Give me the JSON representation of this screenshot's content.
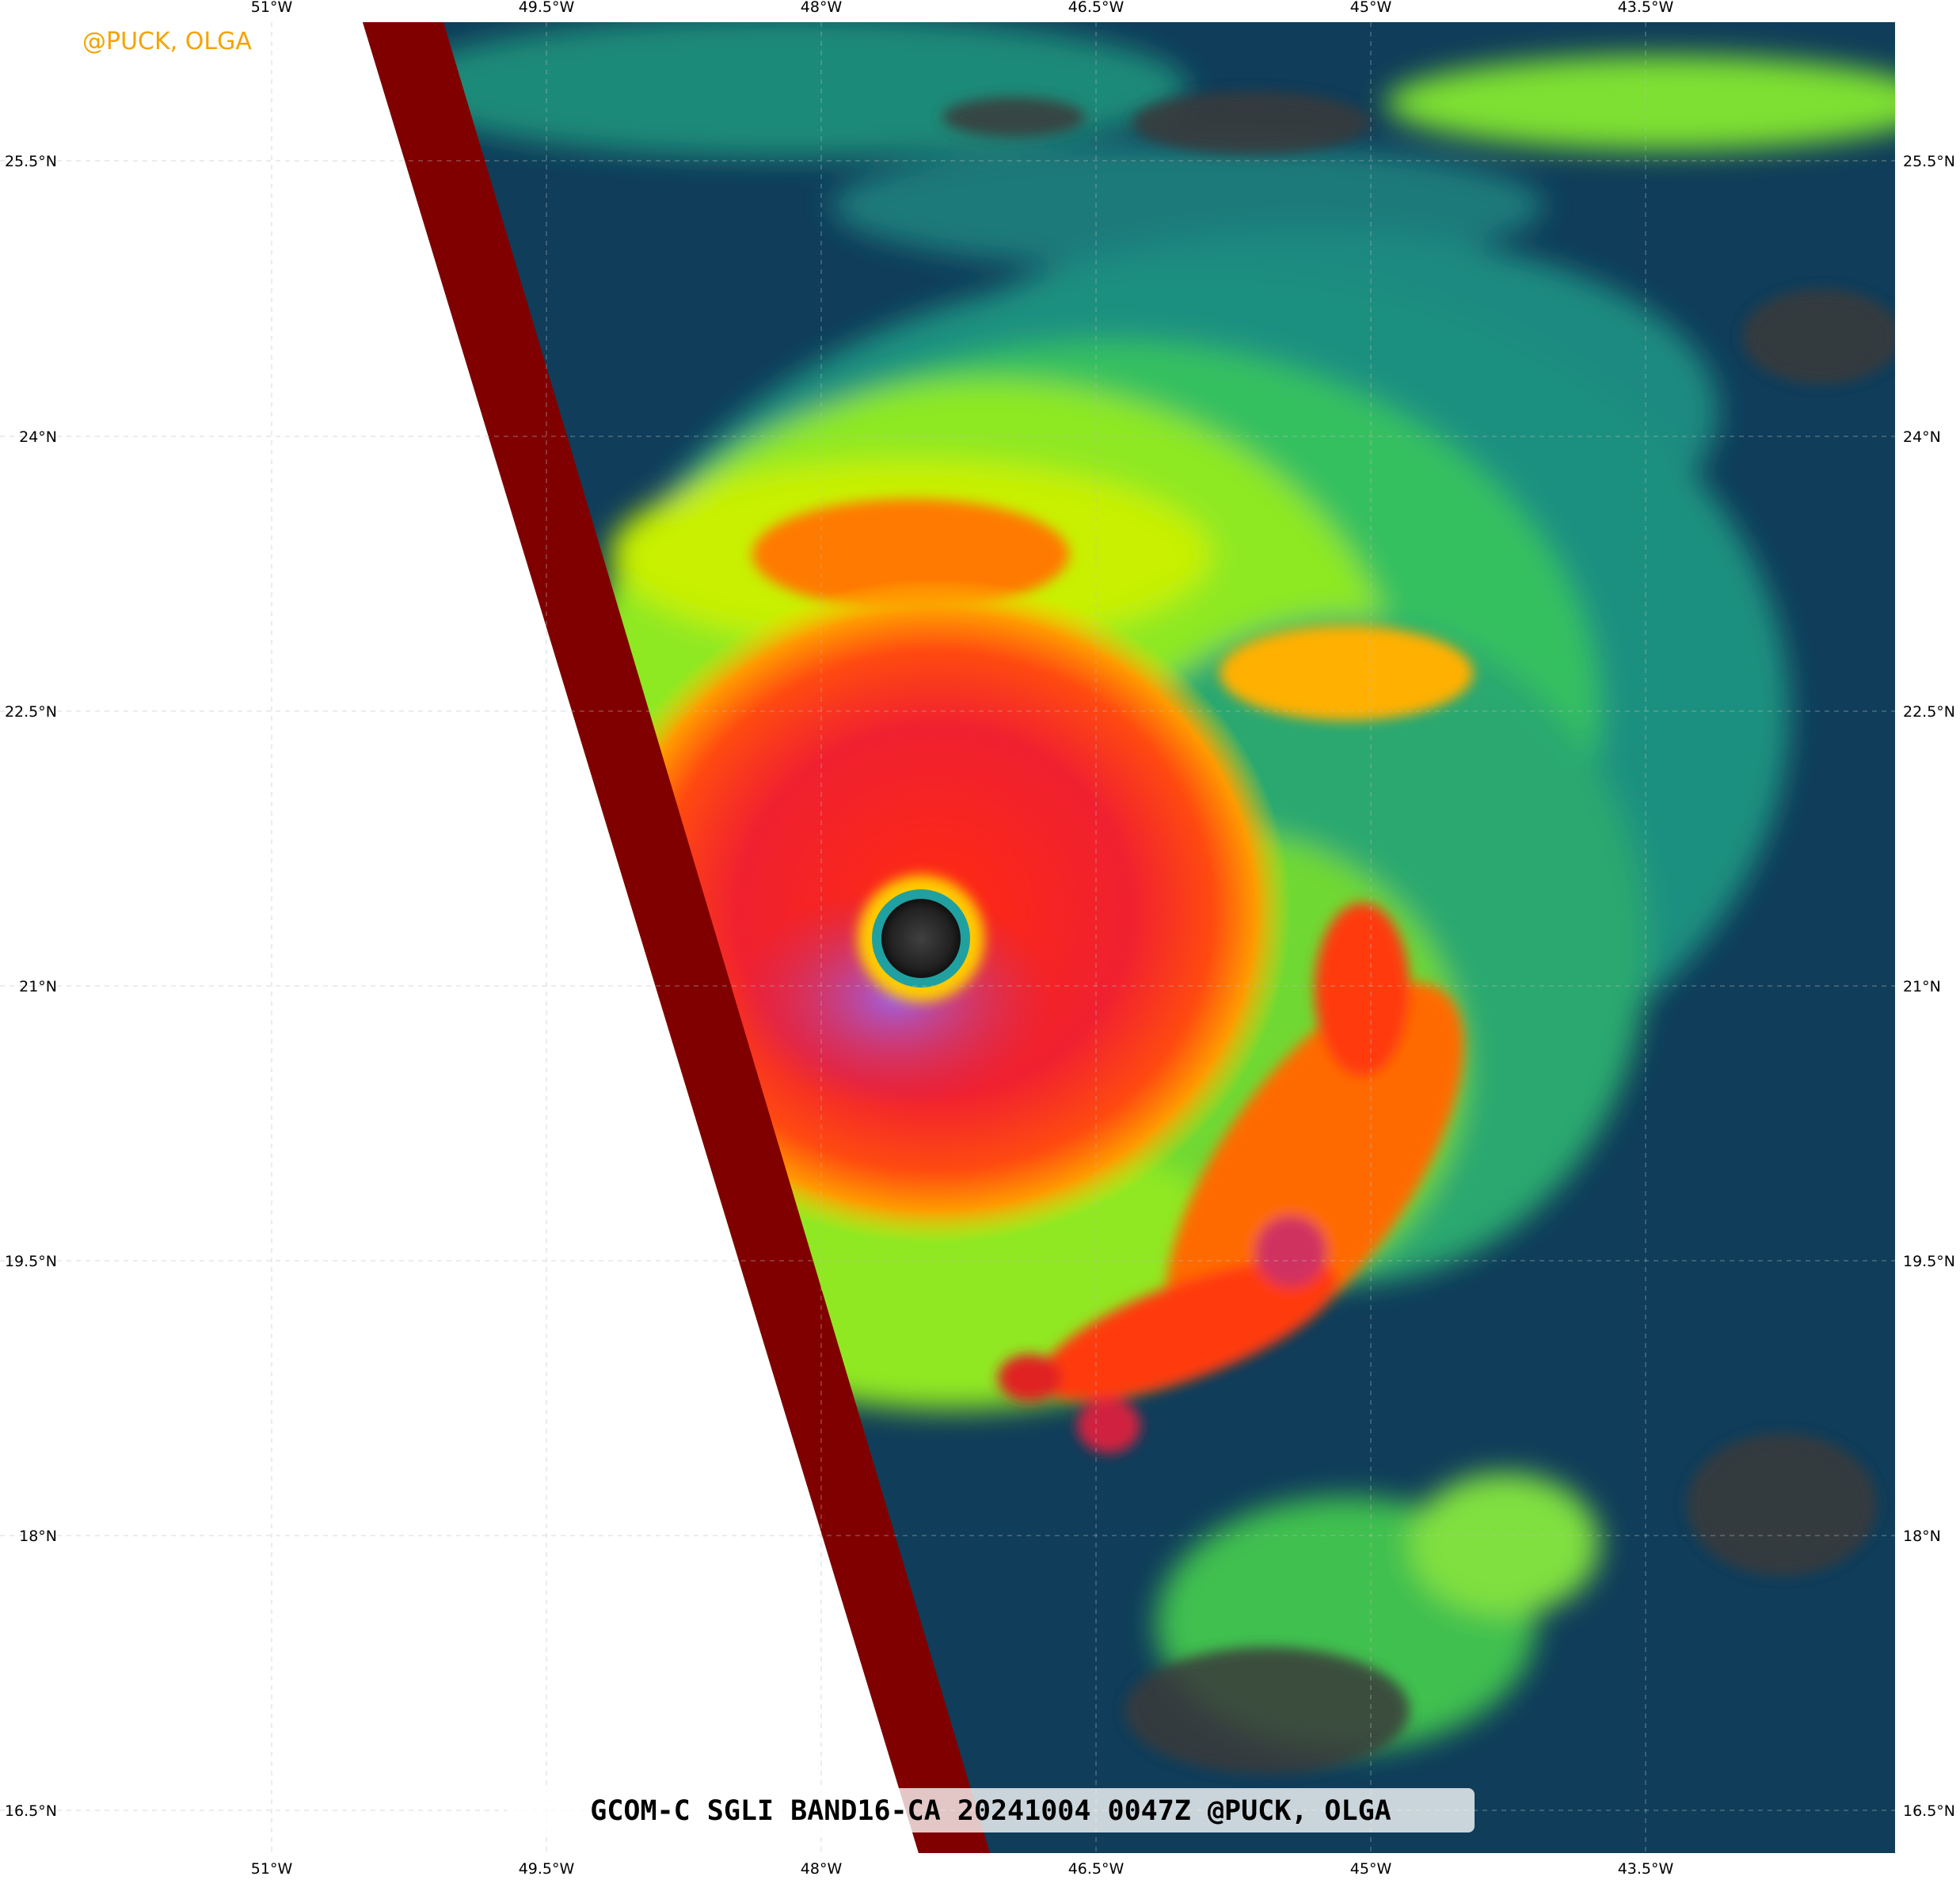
{
  "watermark": "@PUCK, OLGA",
  "caption": "GCOM-C SGLI BAND16-CA 20241004 0047Z @PUCK, OLGA",
  "colors": {
    "watermark": "#f5a300",
    "no_data_swath": "#800000",
    "background_ocean": "#0f3d5a",
    "eye": "#2a2a2a",
    "eyewall": "#ff3300"
  },
  "axes": {
    "lon_labels": [
      "51°W",
      "49.5°W",
      "48°W",
      "46.5°W",
      "45°W",
      "43.5°W"
    ],
    "lat_labels": [
      "25.5°N",
      "24°N",
      "22.5°N",
      "21°N",
      "19.5°N",
      "18°N",
      "16.5°N"
    ]
  }
}
